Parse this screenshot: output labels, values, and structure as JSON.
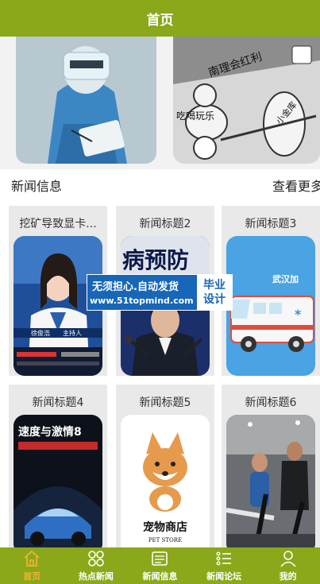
{
  "header": {
    "title": "首页"
  },
  "banner": {
    "left_image": "medical-worker-photo",
    "right_image": "cartoon-illustration",
    "right_caption_top": "南理会红利",
    "right_caption_mid": "吃喝玩乐",
    "right_caption_side": "小金库"
  },
  "news_section": {
    "title": "新闻信息",
    "more": "查看更多"
  },
  "news_cards": [
    {
      "title": "挖矿导致显卡...",
      "image": "news-anchor-photo"
    },
    {
      "title": "新闻标题2",
      "image": "press-conference-photo",
      "image_text": "病预防"
    },
    {
      "title": "新闻标题3",
      "image": "ambulance-illustration",
      "image_text": "武汉加"
    },
    {
      "title": "新闻标题4",
      "image": "car-movie-poster",
      "image_text": "速度与激情8"
    },
    {
      "title": "新闻标题5",
      "image": "pet-store-logo",
      "image_text": "宠物商店",
      "image_subtext": "PET STORE"
    },
    {
      "title": "新闻标题6",
      "image": "gym-photo"
    }
  ],
  "anchor_ticker": {
    "name": "徐俊浩",
    "role": "主持人"
  },
  "watermark": {
    "line1": "无须担心.自动发货",
    "line2": "www.51topmind.com",
    "side1": "毕业",
    "side2": "设计"
  },
  "tabbar": [
    {
      "label": "首页",
      "icon": "home-icon",
      "active": true
    },
    {
      "label": "热点新闻",
      "icon": "grid-icon",
      "active": false
    },
    {
      "label": "新闻信息",
      "icon": "newspaper-icon",
      "active": false
    },
    {
      "label": "新闻论坛",
      "icon": "list-icon",
      "active": false
    },
    {
      "label": "我的",
      "icon": "user-icon",
      "active": false
    }
  ],
  "colors": {
    "primary": "#8aa81a",
    "active_tab": "#f0b230",
    "watermark": "#1766b7"
  }
}
